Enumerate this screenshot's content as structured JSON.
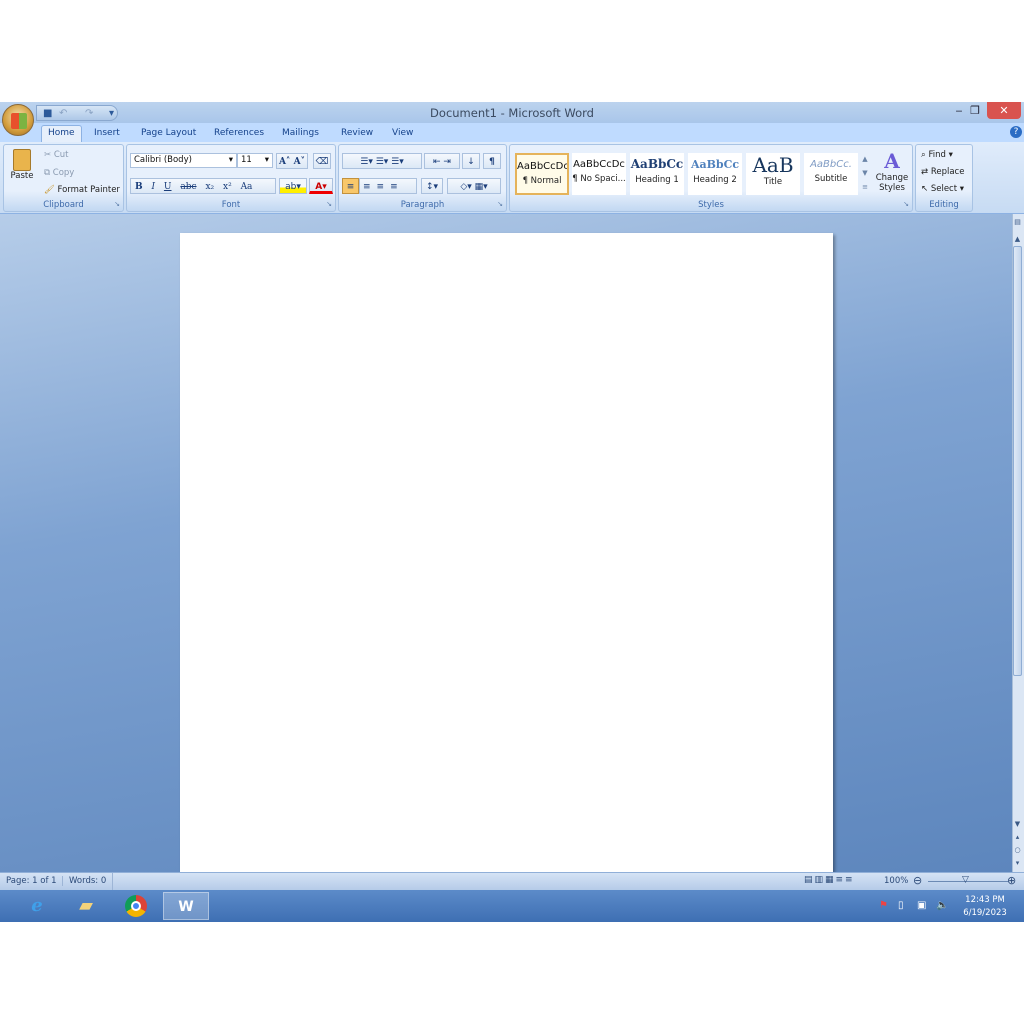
{
  "window": {
    "title": "Document1 - Microsoft Word"
  },
  "tabs": [
    "Home",
    "Insert",
    "Page Layout",
    "References",
    "Mailings",
    "Review",
    "View"
  ],
  "clipboard": {
    "paste": "Paste",
    "cut": "Cut",
    "copy": "Copy",
    "format_painter": "Format Painter",
    "label": "Clipboard"
  },
  "font": {
    "name": "Calibri (Body)",
    "size": "11",
    "label": "Font",
    "bold": "B",
    "italic": "I",
    "underline": "U",
    "strike": "abc",
    "sub": "x₂",
    "sup": "x²",
    "change_case": "Aa",
    "grow": "A˄",
    "shrink": "A˅"
  },
  "paragraph": {
    "label": "Paragraph",
    "show_marks": "¶"
  },
  "styles": {
    "label": "Styles",
    "items": [
      {
        "preview": "AaBbCcDc",
        "name": "¶ Normal"
      },
      {
        "preview": "AaBbCcDc",
        "name": "¶ No Spaci..."
      },
      {
        "preview": "AaBbCc",
        "name": "Heading 1"
      },
      {
        "preview": "AaBbCc",
        "name": "Heading 2"
      },
      {
        "preview": "AaB",
        "name": "Title"
      },
      {
        "preview": "AaBbCc.",
        "name": "Subtitle"
      }
    ],
    "change_styles": "Change Styles"
  },
  "editing": {
    "find": "Find",
    "replace": "Replace",
    "select": "Select",
    "label": "Editing"
  },
  "status": {
    "page": "Page: 1 of 1",
    "words": "Words: 0",
    "zoom": "100%"
  },
  "taskbar": {
    "time": "12:43 PM",
    "date": "6/19/2023"
  }
}
